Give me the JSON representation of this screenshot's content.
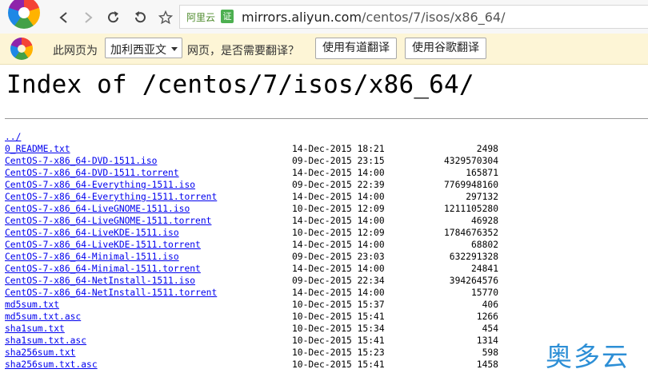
{
  "toolbar": {
    "back_icon": "chevron-left-icon",
    "forward_icon": "chevron-right-icon",
    "reload_icon": "reload-icon",
    "undo_icon": "undo-icon",
    "bookmark_icon": "star-icon",
    "aliyun_label": "阿里云",
    "cert_label": "证",
    "url_host": "mirrors.aliyun.com",
    "url_path": "/centos/7/isos/x86_64/"
  },
  "translate_bar": {
    "prefix": "此网页为",
    "language": "加利西亚文",
    "suffix": "网页，是否需要翻译？",
    "youdao_button": "使用有道翻译",
    "google_button": "使用谷歌翻译"
  },
  "page": {
    "title": "Index of /centos/7/isos/x86_64/",
    "parent_link": "../",
    "files": [
      {
        "name": "0_README.txt",
        "date": "14-Dec-2015 18:21",
        "size": "2498"
      },
      {
        "name": "CentOS-7-x86_64-DVD-1511.iso",
        "date": "09-Dec-2015 23:15",
        "size": "4329570304"
      },
      {
        "name": "CentOS-7-x86_64-DVD-1511.torrent",
        "date": "14-Dec-2015 14:00",
        "size": "165871"
      },
      {
        "name": "CentOS-7-x86_64-Everything-1511.iso",
        "date": "09-Dec-2015 22:39",
        "size": "7769948160"
      },
      {
        "name": "CentOS-7-x86_64-Everything-1511.torrent",
        "date": "14-Dec-2015 14:00",
        "size": "297132"
      },
      {
        "name": "CentOS-7-x86_64-LiveGNOME-1511.iso",
        "date": "10-Dec-2015 12:09",
        "size": "1211105280"
      },
      {
        "name": "CentOS-7-x86_64-LiveGNOME-1511.torrent",
        "date": "14-Dec-2015 14:00",
        "size": "46928"
      },
      {
        "name": "CentOS-7-x86_64-LiveKDE-1511.iso",
        "date": "10-Dec-2015 12:09",
        "size": "1784676352"
      },
      {
        "name": "CentOS-7-x86_64-LiveKDE-1511.torrent",
        "date": "14-Dec-2015 14:00",
        "size": "68802"
      },
      {
        "name": "CentOS-7-x86_64-Minimal-1511.iso",
        "date": "09-Dec-2015 23:03",
        "size": "632291328"
      },
      {
        "name": "CentOS-7-x86_64-Minimal-1511.torrent",
        "date": "14-Dec-2015 14:00",
        "size": "24841"
      },
      {
        "name": "CentOS-7-x86_64-NetInstall-1511.iso",
        "date": "09-Dec-2015 22:34",
        "size": "394264576"
      },
      {
        "name": "CentOS-7-x86_64-NetInstall-1511.torrent",
        "date": "14-Dec-2015 14:00",
        "size": "15770"
      },
      {
        "name": "md5sum.txt",
        "date": "10-Dec-2015 15:37",
        "size": "406"
      },
      {
        "name": "md5sum.txt.asc",
        "date": "10-Dec-2015 15:41",
        "size": "1266"
      },
      {
        "name": "sha1sum.txt",
        "date": "10-Dec-2015 15:34",
        "size": "454"
      },
      {
        "name": "sha1sum.txt.asc",
        "date": "10-Dec-2015 15:41",
        "size": "1314"
      },
      {
        "name": "sha256sum.txt",
        "date": "10-Dec-2015 15:23",
        "size": "598"
      },
      {
        "name": "sha256sum.txt.asc",
        "date": "10-Dec-2015 15:41",
        "size": "1458"
      }
    ]
  },
  "watermark": "奥多云",
  "colors": {
    "link": "#0000ee",
    "translate_bar_bg": "#fdf5d6",
    "watermark": "#2d8fd6"
  }
}
